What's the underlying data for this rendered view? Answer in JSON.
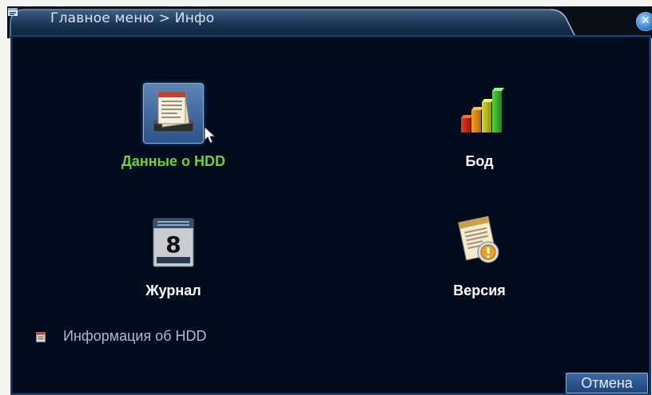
{
  "window": {
    "breadcrumb": "Главное меню > Инфо",
    "close_glyph": "✕",
    "icon": "menu-window-icon"
  },
  "menu": {
    "items": [
      {
        "label": "Данные о HDD",
        "icon": "hdd-document-icon",
        "selected": true
      },
      {
        "label": "Бод",
        "icon": "bar-chart-icon",
        "selected": false
      },
      {
        "label": "Журнал",
        "icon": "calendar-log-icon",
        "calendar_day": "8",
        "selected": false
      },
      {
        "label": "Версия",
        "icon": "version-document-icon",
        "selected": false
      }
    ]
  },
  "status": {
    "text": "Информация об HDD",
    "icon": "info-square-icon"
  },
  "footer": {
    "cancel_label": "Отмена"
  },
  "colors": {
    "panel_bg": "#000c1e",
    "active_label": "#6ecf3a",
    "label": "#ffffff",
    "info_text": "#aab9d6",
    "titlebar": "#17314f"
  }
}
